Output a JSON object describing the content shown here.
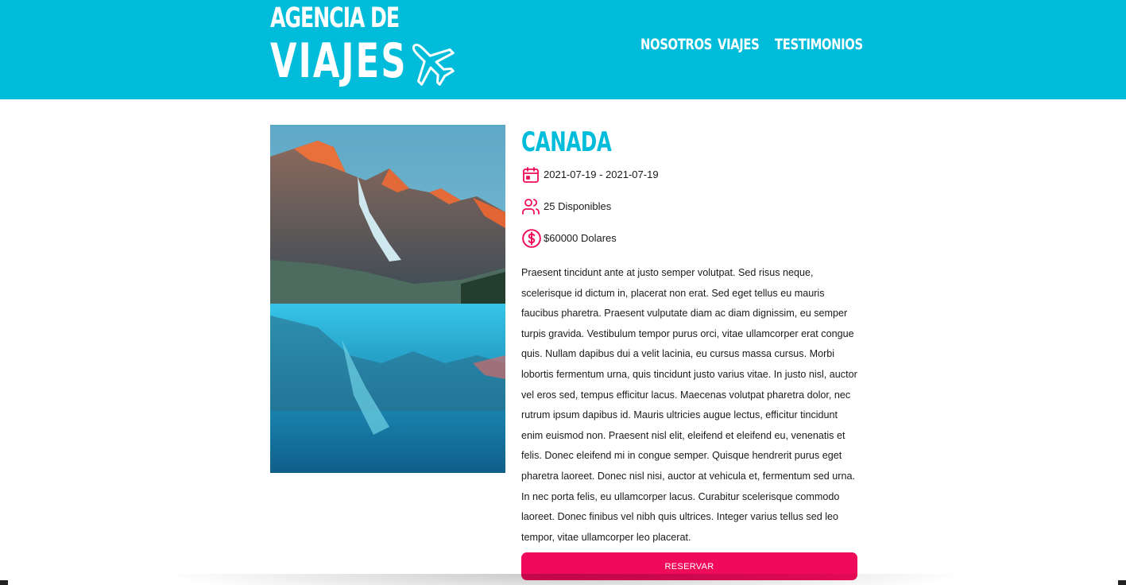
{
  "header": {
    "logo_line1": "AGENCIA DE",
    "logo_line2": "VIAJES",
    "logo_icon": "airplane-icon",
    "nav": [
      {
        "label": "NOSOTROS"
      },
      {
        "label": "VIAJES"
      },
      {
        "label": "TESTIMONIOS"
      }
    ]
  },
  "trip": {
    "image": "mountain-lake-photo",
    "title": "CANADA",
    "dates": "2021-07-19 - 2021-07-19",
    "availability": "25 Disponibles",
    "price": "$60000 Dolares",
    "description": "Praesent tincidunt ante at justo semper volutpat. Sed risus neque, scelerisque id dictum in, placerat non erat. Sed eget tellus eu mauris faucibus pharetra. Praesent vulputate diam ac diam dignissim, eu semper turpis gravida. Vestibulum tempor purus orci, vitae ullamcorper erat congue quis. Nullam dapibus dui a velit lacinia, eu cursus massa cursus. Morbi lobortis fermentum urna, quis tincidunt justo varius vitae. In justo nisl, auctor vel eros sed, tempus efficitur lacus. Maecenas volutpat pharetra dolor, nec rutrum ipsum dapibus id. Mauris ultricies augue lectus, efficitur tincidunt enim euismod non. Praesent nisl elit, eleifend et eleifend eu, venenatis et felis. Donec eleifend mi in congue semper. Quisque hendrerit purus eget pharetra laoreet. Donec nisl nisi, auctor at vehicula et, fermentum sed urna. In nec porta felis, eu ullamcorper lacus. Curabitur scelerisque commodo laoreet. Donec finibus vel nibh quis ultrices. Integer varius tellus sed leo tempor, vitae ullamcorper leo placerat.",
    "button_label": "RESERVAR"
  },
  "colors": {
    "header_bg": "#00bcdb",
    "accent": "#f00a5a",
    "title": "#00bcdb"
  },
  "icons": {
    "date": "calendar-icon",
    "availability": "users-icon",
    "price": "dollar-circle-icon"
  }
}
